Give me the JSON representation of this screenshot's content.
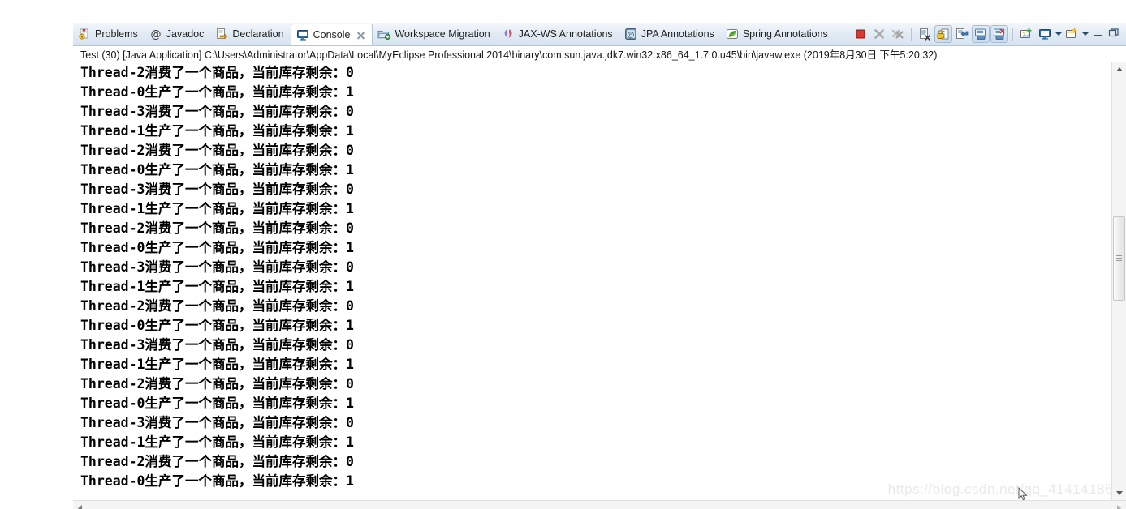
{
  "window": {
    "background_color": "#ffffff"
  },
  "tabs": [
    {
      "label": "Problems",
      "icon": "problems-icon",
      "active": false
    },
    {
      "label": "Javadoc",
      "icon": "javadoc-at-icon",
      "active": false
    },
    {
      "label": "Declaration",
      "icon": "declaration-icon",
      "active": false
    },
    {
      "label": "Console",
      "icon": "console-monitor-icon",
      "active": true
    },
    {
      "label": "Workspace Migration",
      "icon": "workspace-migration-icon",
      "active": false
    },
    {
      "label": "JAX-WS Annotations",
      "icon": "jaxws-icon",
      "active": false
    },
    {
      "label": "JPA Annotations",
      "icon": "jpa-icon",
      "active": false
    },
    {
      "label": "Spring Annotations",
      "icon": "spring-leaf-icon",
      "active": false
    }
  ],
  "toolbar": {
    "buttons": [
      {
        "name": "terminate-button",
        "icon": "terminate-red-square-icon",
        "enabled": true,
        "pressed": false
      },
      {
        "name": "remove-launch-button",
        "icon": "remove-x-icon",
        "enabled": false,
        "pressed": false
      },
      {
        "name": "remove-all-launches-button",
        "icon": "remove-all-xx-icon",
        "enabled": false,
        "pressed": false
      },
      {
        "name": "clear-console-button",
        "icon": "clear-console-icon",
        "enabled": true,
        "pressed": false
      },
      {
        "name": "scroll-lock-button",
        "icon": "scroll-lock-icon",
        "enabled": true,
        "pressed": true
      },
      {
        "name": "word-wrap-button",
        "icon": "word-wrap-icon",
        "enabled": true,
        "pressed": false
      },
      {
        "name": "show-console-on-output-button",
        "icon": "show-console-output-icon",
        "enabled": true,
        "pressed": true
      },
      {
        "name": "show-console-on-error-button",
        "icon": "show-console-error-icon",
        "enabled": true,
        "pressed": true
      },
      {
        "name": "pin-console-button",
        "icon": "pin-console-icon",
        "enabled": true,
        "pressed": false
      },
      {
        "name": "display-selected-console-button",
        "icon": "display-console-icon",
        "enabled": true,
        "pressed": false
      },
      {
        "name": "open-console-button",
        "icon": "open-console-icon",
        "enabled": true,
        "pressed": false
      },
      {
        "name": "minimize-view-button",
        "icon": "minimize-icon",
        "enabled": true,
        "pressed": false
      },
      {
        "name": "maximize-view-button",
        "icon": "maximize-icon",
        "enabled": true,
        "pressed": false
      }
    ]
  },
  "launch": {
    "line": "Test (30) [Java Application] C:\\Users\\Administrator\\AppData\\Local\\MyEclipse Professional 2014\\binary\\com.sun.java.jdk7.win32.x86_64_1.7.0.u45\\bin\\javaw.exe (2019年8月30日 下午5:20:32)"
  },
  "console": {
    "lines": [
      "Thread-2消费了一个商品，当前库存剩余：0",
      "Thread-0生产了一个商品，当前库存剩余：1",
      "Thread-3消费了一个商品，当前库存剩余：0",
      "Thread-1生产了一个商品，当前库存剩余：1",
      "Thread-2消费了一个商品，当前库存剩余：0",
      "Thread-0生产了一个商品，当前库存剩余：1",
      "Thread-3消费了一个商品，当前库存剩余：0",
      "Thread-1生产了一个商品，当前库存剩余：1",
      "Thread-2消费了一个商品，当前库存剩余：0",
      "Thread-0生产了一个商品，当前库存剩余：1",
      "Thread-3消费了一个商品，当前库存剩余：0",
      "Thread-1生产了一个商品，当前库存剩余：1",
      "Thread-2消费了一个商品，当前库存剩余：0",
      "Thread-0生产了一个商品，当前库存剩余：1",
      "Thread-3消费了一个商品，当前库存剩余：0",
      "Thread-1生产了一个商品，当前库存剩余：1",
      "Thread-2消费了一个商品，当前库存剩余：0",
      "Thread-0生产了一个商品，当前库存剩余：1",
      "Thread-3消费了一个商品，当前库存剩余：0",
      "Thread-1生产了一个商品，当前库存剩余：1",
      "Thread-2消费了一个商品，当前库存剩余：0",
      "Thread-0生产了一个商品，当前库存剩余：1"
    ]
  },
  "watermark": {
    "text": "https://blog.csdn.net/qq_41414186"
  },
  "colors": {
    "accent_blue": "#3a6ea5",
    "terminate_red": "#d43a2f",
    "tab_active_bg": "#ffffff",
    "tab_bar_bg": "#dde8f3",
    "console_text": "#000000",
    "watermark_gray": "#e9e9e9"
  }
}
